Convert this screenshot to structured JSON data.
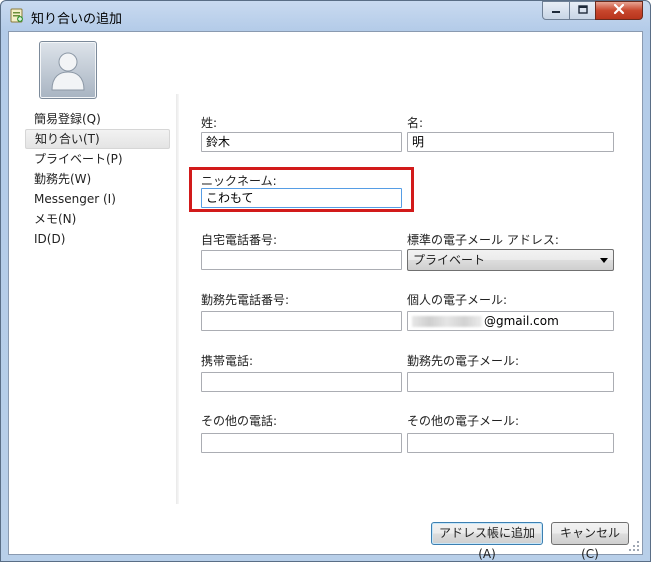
{
  "window": {
    "title": "知り合いの追加",
    "controls": {
      "minimize": "minimize-icon",
      "maximize": "maximize-icon",
      "close": "close-icon"
    }
  },
  "avatar": {
    "icon": "contact-silhouette-icon"
  },
  "nav": {
    "items": [
      {
        "label": "簡易登録(Q)",
        "selected": false
      },
      {
        "label": "知り合い(T)",
        "selected": true
      },
      {
        "label": "プライベート(P)",
        "selected": false
      },
      {
        "label": "勤務先(W)",
        "selected": false
      },
      {
        "label": "Messenger (I)",
        "selected": false
      },
      {
        "label": "メモ(N)",
        "selected": false
      },
      {
        "label": "ID(D)",
        "selected": false
      }
    ]
  },
  "form": {
    "last_name": {
      "label": "姓:",
      "value": "鈴木"
    },
    "first_name": {
      "label": "名:",
      "value": "明"
    },
    "nickname": {
      "label": "ニックネーム:",
      "value": "こわもて"
    },
    "home_phone": {
      "label": "自宅電話番号:",
      "value": ""
    },
    "default_email": {
      "label": "標準の電子メール アドレス:",
      "value": "プライベート"
    },
    "work_phone": {
      "label": "勤務先電話番号:",
      "value": ""
    },
    "personal_email": {
      "label": "個人の電子メール:",
      "value": "@gmail.com"
    },
    "mobile_phone": {
      "label": "携帯電話:",
      "value": ""
    },
    "work_email": {
      "label": "勤務先の電子メール:",
      "value": ""
    },
    "other_phone": {
      "label": "その他の電話:",
      "value": ""
    },
    "other_email": {
      "label": "その他の電子メール:",
      "value": ""
    }
  },
  "buttons": {
    "add": "アドレス帳に追加(A)",
    "cancel": "キャンセル(C)"
  },
  "colors": {
    "highlight": "#d21a1a",
    "frame": "#b8cfe9",
    "close_button": "#c8472d"
  }
}
